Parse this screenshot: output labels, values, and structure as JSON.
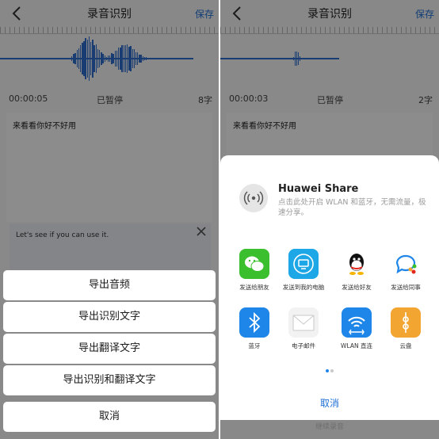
{
  "left": {
    "header": {
      "title": "录音识别",
      "save_label": "保存"
    },
    "status": {
      "time": "00:00:05",
      "state": "已暂停",
      "count": "8字"
    },
    "content_text": "来看看你好不好用",
    "translation_text": "Let's see if you can use it.",
    "action_sheet": {
      "items": [
        "导出音频",
        "导出识别文字",
        "导出翻译文字",
        "导出识别和翻译文字"
      ],
      "cancel_label": "取消"
    }
  },
  "right": {
    "header": {
      "title": "录音识别",
      "save_label": "保存"
    },
    "status": {
      "time": "00:00:03",
      "state": "已暂停",
      "count": "2字"
    },
    "content_text": "来看看你好不好用",
    "share": {
      "huawei_share_title": "Huawei Share",
      "huawei_share_desc": "点击此处开启 WLAN 和蓝牙，无需流量，极速分享。",
      "row1": [
        {
          "label": "发送给朋友",
          "icon": "wechat-icon",
          "color": "#3bbf2f"
        },
        {
          "label": "发送到我的电脑",
          "icon": "computer-icon",
          "color": "#1ea7e6"
        },
        {
          "label": "发送给好友",
          "icon": "qq-icon",
          "color": "#ffffff"
        },
        {
          "label": "发送给同事",
          "icon": "work-chat-icon",
          "color": "#ffffff"
        }
      ],
      "row2": [
        {
          "label": "蓝牙",
          "icon": "bluetooth-icon",
          "color": "#1e86e8"
        },
        {
          "label": "电子邮件",
          "icon": "email-icon",
          "color": "#f2f2f2"
        },
        {
          "label": "WLAN 直连",
          "icon": "wlan-direct-icon",
          "color": "#1e86e8"
        },
        {
          "label": "云盘",
          "icon": "cloud-drive-icon",
          "color": "#f2a531"
        }
      ],
      "cancel_label": "取消"
    },
    "continue_label": "继续录音"
  },
  "accent_color": "#1e6fd6"
}
